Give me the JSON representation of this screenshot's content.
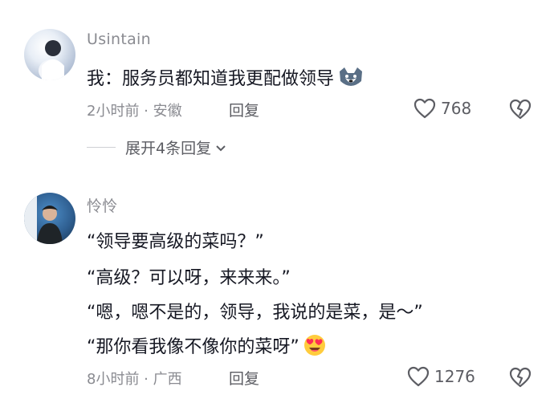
{
  "comments": [
    {
      "author": "Usintain",
      "lines": [
        "我：服务员都知道我更配做领导"
      ],
      "emoji": "dog-emoji",
      "time_location": "2小时前 · 安徽",
      "reply_label": "回复",
      "likes": "768"
    },
    {
      "author": "怜怜",
      "lines": [
        "“领导要高级的菜吗？”",
        "“高级？可以呀，来来来。”",
        "“嗯，嗯不是的，领导，我说的是菜，是～”",
        "“那你看我像不像你的菜呀”"
      ],
      "emoji": "heart-eyes-emoji",
      "time_location": "8小时前 · 广西",
      "reply_label": "回复",
      "likes": "1276"
    }
  ],
  "expand_replies": "展开4条回复"
}
